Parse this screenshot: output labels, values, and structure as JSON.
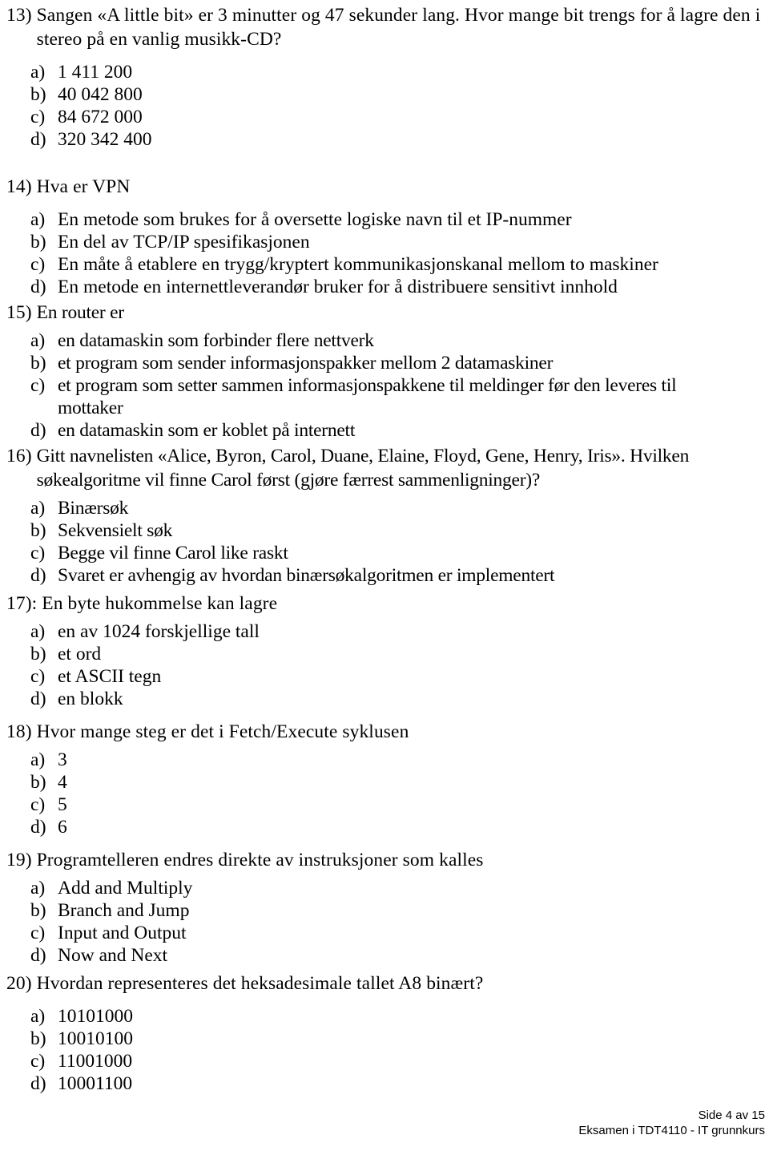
{
  "document": {
    "language": "no",
    "page_label": "Side 4 av 15",
    "footer_course": "Eksamen i TDT4110 - IT grunnkurs"
  },
  "questions": [
    {
      "number": "13)",
      "stem": "Sangen «A little bit» er 3 minutter og 47 sekunder lang. Hvor mange bit trengs for å lagre den i stereo på en vanlig musikk-CD?",
      "options": [
        {
          "label": "a)",
          "text": "1 411 200"
        },
        {
          "label": "b)",
          "text": "40 042 800"
        },
        {
          "label": "c)",
          "text": "84 672 000"
        },
        {
          "label": "d)",
          "text": "320 342 400"
        }
      ]
    },
    {
      "number": "14)",
      "stem": "Hva er VPN",
      "options": [
        {
          "label": "a)",
          "text": "En metode som brukes for å oversette logiske navn til et IP-nummer"
        },
        {
          "label": "b)",
          "text": "En del av TCP/IP spesifikasjonen"
        },
        {
          "label": "c)",
          "text": "En måte å etablere en trygg/kryptert kommunikasjonskanal mellom to maskiner"
        },
        {
          "label": "d)",
          "text": "En metode en internettleverandør bruker for å distribuere sensitivt innhold"
        }
      ]
    },
    {
      "number": "15)",
      "stem": "En router er",
      "options": [
        {
          "label": "a)",
          "text": "en datamaskin som forbinder flere nettverk"
        },
        {
          "label": "b)",
          "text": "et program som sender informasjonspakker mellom 2 datamaskiner"
        },
        {
          "label": "c)",
          "text": "et program som setter sammen informasjonspakkene til meldinger før den leveres til mottaker"
        },
        {
          "label": "d)",
          "text": "en datamaskin som er koblet på internett"
        }
      ]
    },
    {
      "number": "16)",
      "stem": "Gitt navnelisten «Alice, Byron, Carol, Duane, Elaine, Floyd, Gene, Henry, Iris». Hvilken søkealgoritme vil finne Carol først (gjøre færrest sammenligninger)?",
      "options": [
        {
          "label": "a)",
          "text": "Binærsøk"
        },
        {
          "label": "b)",
          "text": "Sekvensielt søk"
        },
        {
          "label": "c)",
          "text": "Begge vil finne Carol like raskt"
        },
        {
          "label": "d)",
          "text": "Svaret er avhengig av hvordan binærsøkalgoritmen er implementert"
        }
      ]
    },
    {
      "number": "17):",
      "stem": "En byte hukommelse kan lagre",
      "options": [
        {
          "label": "a)",
          "text": "en av 1024 forskjellige tall"
        },
        {
          "label": "b)",
          "text": "et ord"
        },
        {
          "label": "c)",
          "text": "et ASCII tegn"
        },
        {
          "label": "d)",
          "text": "en blokk"
        }
      ]
    },
    {
      "number": "18)",
      "stem": "Hvor mange steg er det i Fetch/Execute syklusen",
      "options": [
        {
          "label": "a)",
          "text": "3"
        },
        {
          "label": "b)",
          "text": "4"
        },
        {
          "label": "c)",
          "text": "5"
        },
        {
          "label": "d)",
          "text": "6"
        }
      ]
    },
    {
      "number": "19)",
      "stem": "Programtelleren endres direkte av instruksjoner som kalles",
      "options": [
        {
          "label": "a)",
          "text": "Add and Multiply"
        },
        {
          "label": "b)",
          "text": "Branch and Jump"
        },
        {
          "label": "c)",
          "text": "Input and Output"
        },
        {
          "label": "d)",
          "text": "Now and Next"
        }
      ]
    },
    {
      "number": "20)",
      "stem": "Hvordan representeres det heksadesimale tallet A8 binært?",
      "options": [
        {
          "label": "a)",
          "text": "10101000"
        },
        {
          "label": "b)",
          "text": "10010100"
        },
        {
          "label": "c)",
          "text": "11001000"
        },
        {
          "label": "d)",
          "text": "10001100"
        }
      ]
    }
  ]
}
